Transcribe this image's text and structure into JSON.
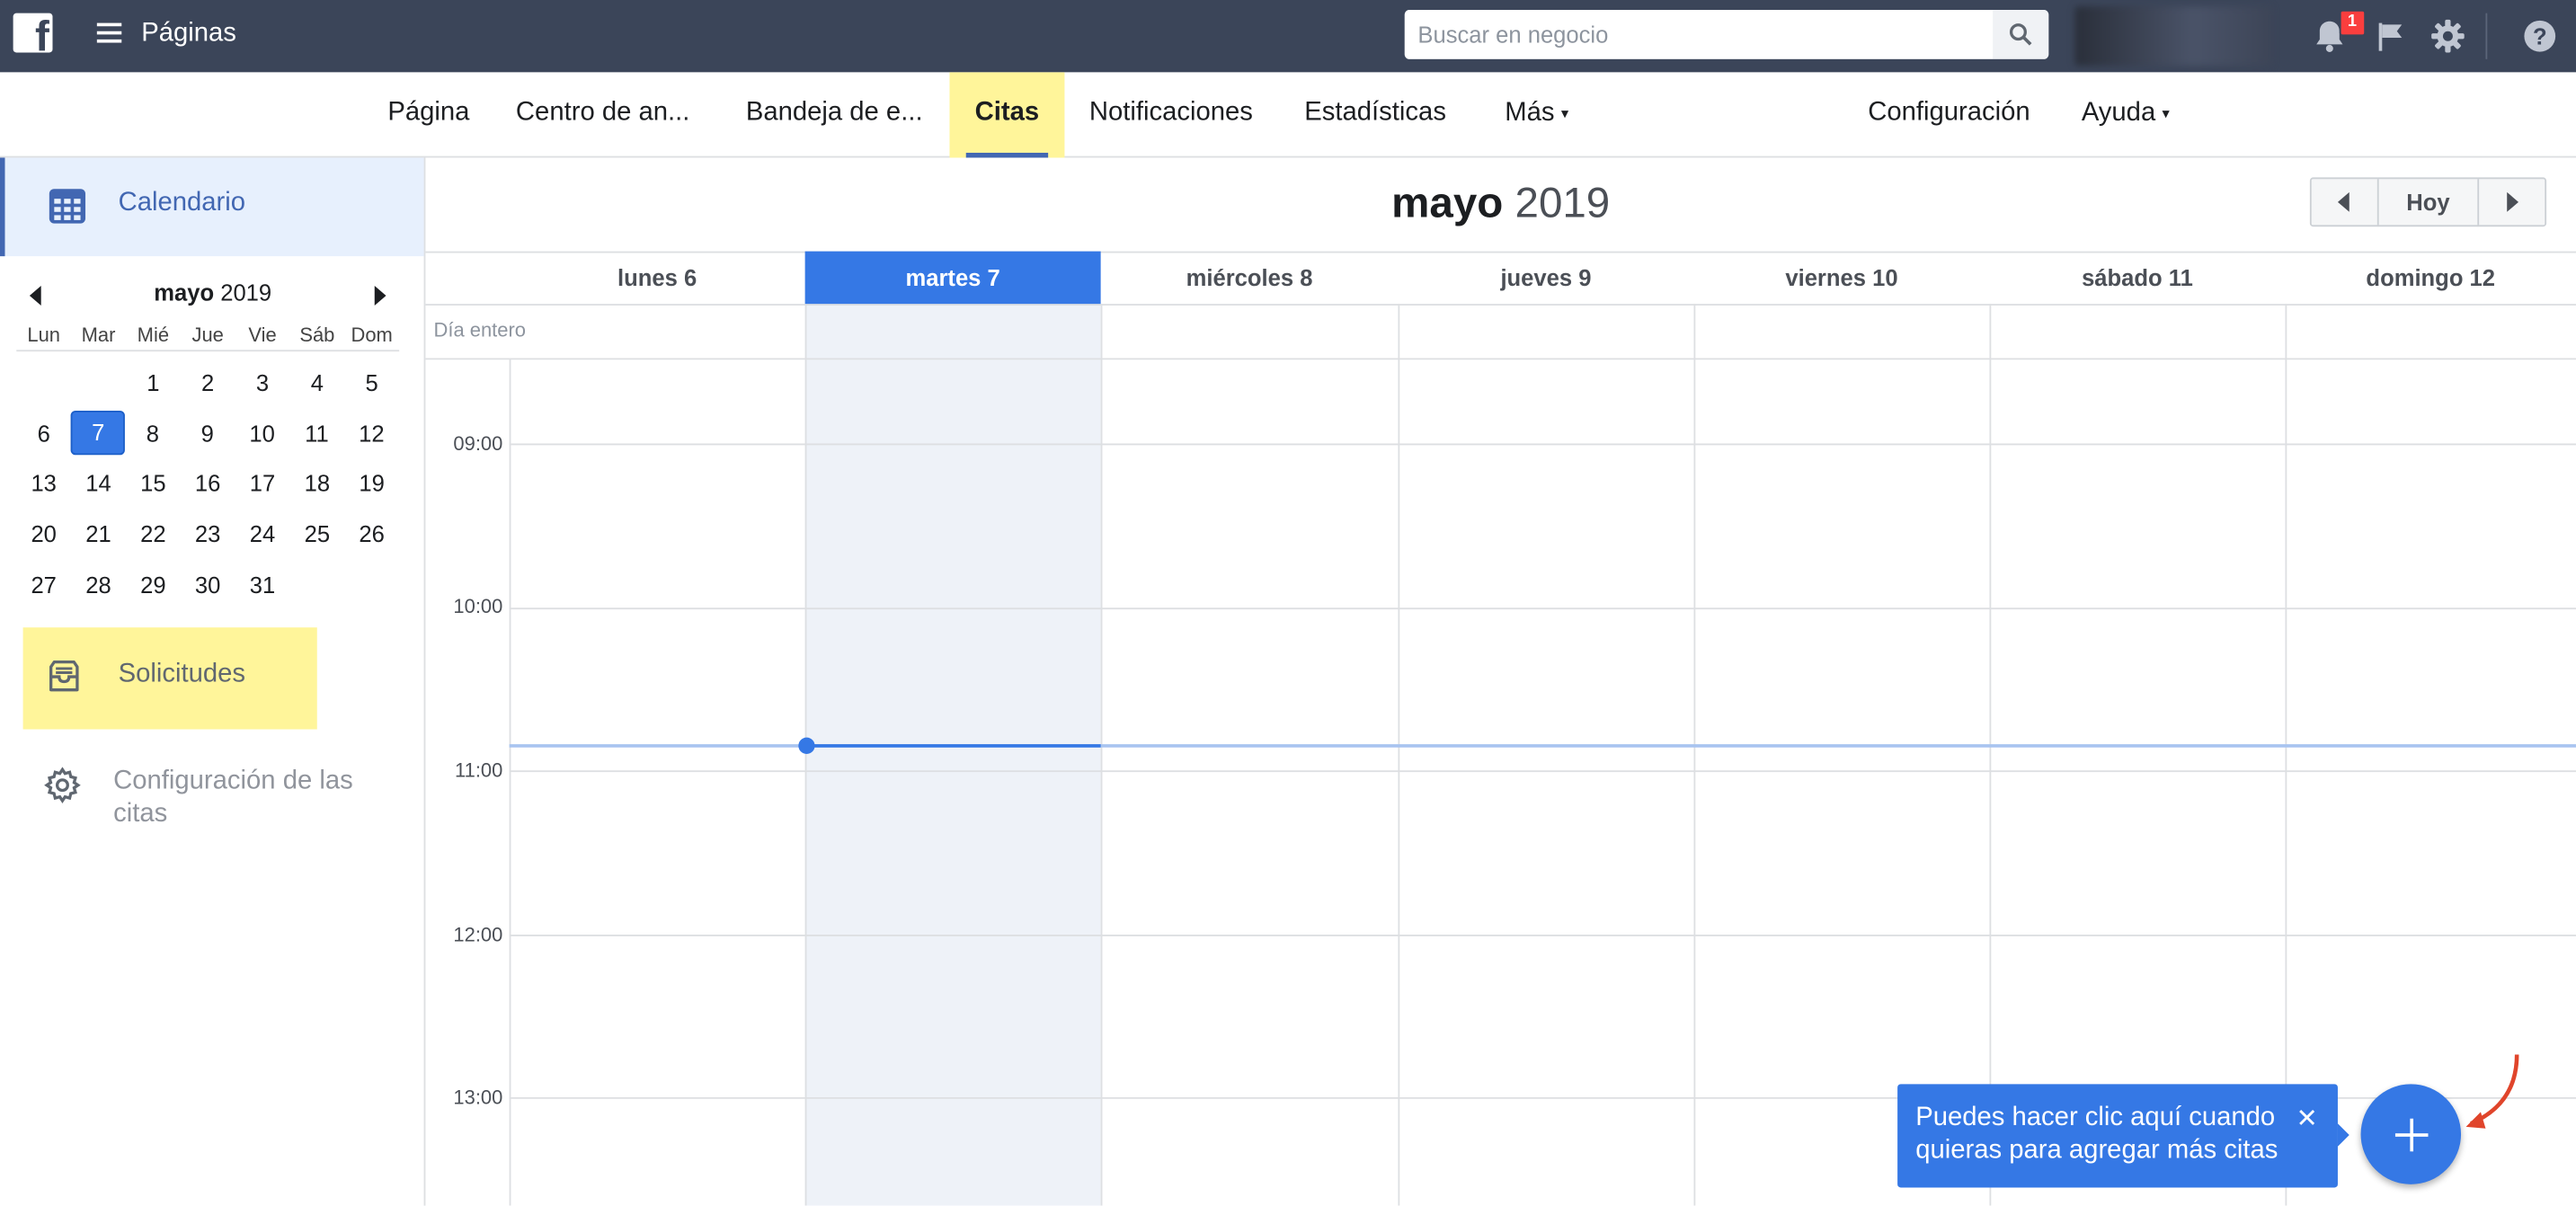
{
  "topbar": {
    "logo_letter": "f",
    "app_title": "Páginas",
    "search_placeholder": "Buscar en negocio",
    "notification_count": "1"
  },
  "nav": {
    "tabs": [
      {
        "label": "Página"
      },
      {
        "label": "Centro de an..."
      },
      {
        "label": "Bandeja de e..."
      },
      {
        "label": "Citas"
      },
      {
        "label": "Notificaciones"
      },
      {
        "label": "Estadísticas"
      },
      {
        "label": "Más"
      }
    ],
    "right": [
      {
        "label": "Configuración"
      },
      {
        "label": "Ayuda"
      }
    ],
    "active_tab": "Citas",
    "caret": "▾"
  },
  "sidebar": {
    "calendar_label": "Calendario",
    "requests_label": "Solicitudes",
    "settings_label": "Configuración de las citas",
    "mini_calendar": {
      "month": "mayo",
      "year": "2019",
      "weekdays": [
        "Lun",
        "Mar",
        "Mié",
        "Jue",
        "Vie",
        "Sáb",
        "Dom"
      ],
      "weeks": [
        [
          "",
          "",
          "1",
          "2",
          "3",
          "4",
          "5"
        ],
        [
          "6",
          "7",
          "8",
          "9",
          "10",
          "11",
          "12"
        ],
        [
          "13",
          "14",
          "15",
          "16",
          "17",
          "18",
          "19"
        ],
        [
          "20",
          "21",
          "22",
          "23",
          "24",
          "25",
          "26"
        ],
        [
          "27",
          "28",
          "29",
          "30",
          "31",
          "",
          ""
        ]
      ],
      "selected_day": "7"
    }
  },
  "calendar": {
    "month": "mayo",
    "year": "2019",
    "today_button": "Hoy",
    "all_day_label": "Día entero",
    "days": [
      {
        "label": "lunes 6"
      },
      {
        "label": "martes 7"
      },
      {
        "label": "miércoles 8"
      },
      {
        "label": "jueves 9"
      },
      {
        "label": "viernes 10"
      },
      {
        "label": "sábado 11"
      },
      {
        "label": "domingo 12"
      }
    ],
    "selected_day_index": 1,
    "hours": [
      "09:00",
      "10:00",
      "11:00",
      "12:00",
      "13:00"
    ],
    "current_time_indicator": "10:51"
  },
  "tooltip": {
    "text": "Puedes hacer clic aquí cuando quieras para agregar más citas",
    "close": "✕"
  },
  "colors": {
    "topbar": "#3b4559",
    "accent": "#3578e5",
    "highlight": "#fff59a",
    "annotation_arrow": "#e0452b"
  }
}
